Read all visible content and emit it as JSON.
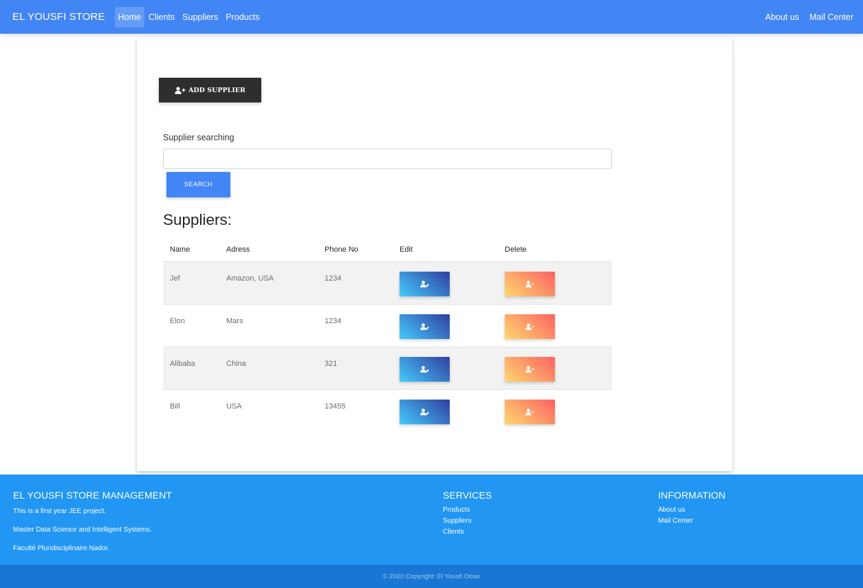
{
  "navbar": {
    "brand": "EL YOUSFI STORE",
    "left_links": [
      "Home",
      "Clients",
      "Suppliers",
      "Products"
    ],
    "active": "Home",
    "right_links": [
      "About us",
      "Mail Center"
    ],
    "color": "#4285f4"
  },
  "toolbar": {
    "add_label": "ADD SUPPLIER",
    "add_icon": "user-plus-icon"
  },
  "search": {
    "label": "Supplier searching",
    "value": "",
    "placeholder": "",
    "button_label": "SEARCH"
  },
  "suppliers": {
    "title": "Suppliers:",
    "columns": [
      "Name",
      "Adress",
      "Phone No",
      "Edit",
      "Delete"
    ],
    "rows": [
      {
        "name": "Jef",
        "address": "Amazon, USA",
        "phone": "1234"
      },
      {
        "name": "Elon",
        "address": "Mars",
        "phone": "1234"
      },
      {
        "name": "Alibaba",
        "address": "China",
        "phone": "321"
      },
      {
        "name": "Bill",
        "address": "USA",
        "phone": "13455"
      }
    ],
    "edit_icon": "user-edit-icon",
    "delete_icon": "user-minus-icon"
  },
  "footer": {
    "about": {
      "title": "EL YOUSFI STORE MANAGEMENT",
      "lines": [
        "This is a first year JEE project.",
        "Master Data Science and Intelligent Systems.",
        "Faculté Pluridisciplinaire Nador."
      ]
    },
    "services": {
      "title": "SERVICES",
      "links": [
        "Products",
        "Suppliers",
        "Clients"
      ]
    },
    "information": {
      "title": "INFORMATION",
      "links": [
        "About us",
        "Mail Center"
      ]
    },
    "copyright": "© 2020 Copyright: El Yousfi Omar",
    "color": "#2196f3",
    "copyright_color": "#1976d2"
  }
}
